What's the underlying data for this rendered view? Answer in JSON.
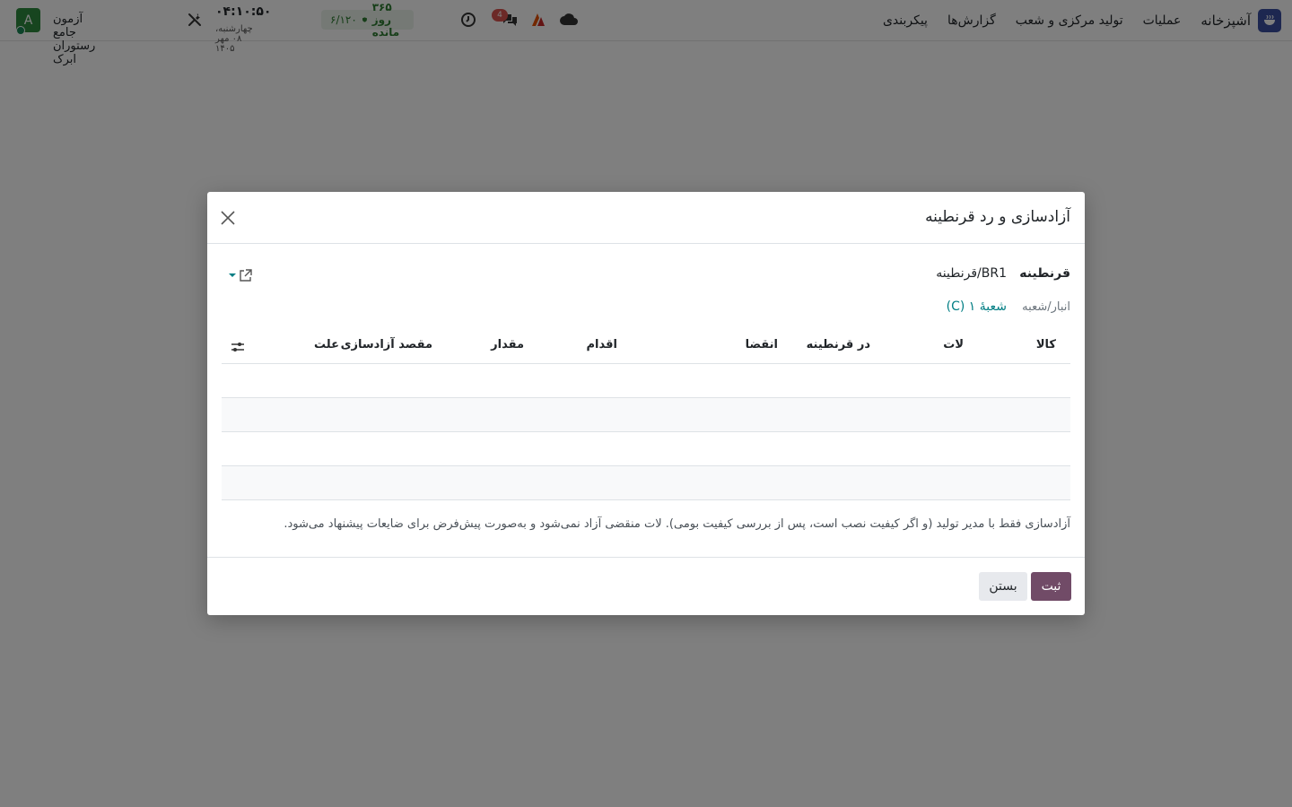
{
  "navbar": {
    "app_name": "آشپزخانه",
    "menu": [
      "عملیات",
      "تولید مرکزی و شعب",
      "گزارش‌ها",
      "پیکربندی"
    ],
    "company": "آزمون جامع رستوران ابرک",
    "avatar_letter": "A",
    "clock_time": "۰۴:۱۰:۵۰",
    "clock_date": "چهارشنبه، ۰۸ مهر ۱۴۰۵",
    "license_days": "۳۶۵ روز مانده",
    "license_count": "۶/۱۲۰",
    "messages_badge": "4"
  },
  "modal": {
    "title": "آزادسازی و رد قرنطینه",
    "quarantine_label": "قرنطینه",
    "quarantine_value": "BR1/قرنطینه",
    "warehouse_label": "انبار/شعبه",
    "warehouse_value": "شعبهٔ ۱ (C)",
    "columns": {
      "product": "کالا",
      "lot": "لات",
      "in_quarantine": "در قرنطینه",
      "expiry": "انقضا",
      "action": "اقدام",
      "quantity": "مقدار",
      "release_destination": "مقصد آزادسازی",
      "reason": "علت"
    },
    "note": "آزادسازی فقط با مدیر تولید (و اگر کیفیت نصب است، پس از بررسی کیفیت بومی). لات منقضی آزاد نمی‌شود و به‌صورت پیش‌فرض برای ضایعات پیشنهاد می‌شود.",
    "save_label": "ثبت",
    "close_label": "بستن"
  }
}
